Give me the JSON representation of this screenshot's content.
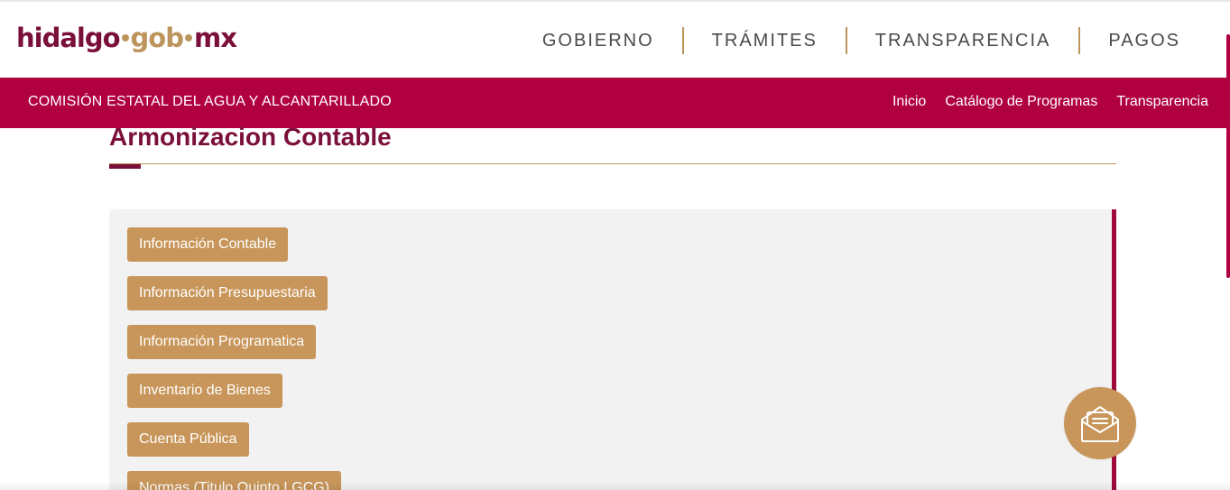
{
  "logo": {
    "part1": "hidalgo",
    "part2": "gob",
    "part3": "mx"
  },
  "main_nav": [
    "GOBIERNO",
    "TRÁMITES",
    "TRANSPARENCIA",
    "PAGOS"
  ],
  "sub_header": {
    "organization": "COMISIÓN ESTATAL DEL AGUA Y ALCANTARILLADO",
    "links": [
      "Inicio",
      "Catálogo de Programas",
      "Transparencia"
    ]
  },
  "page_title": "Armonizacion Contable",
  "section_buttons": [
    "Información Contable",
    "Información Presupuestaria",
    "Información Programatica",
    "Inventario de Bienes",
    "Cuenta Pública",
    "Normas (Titulo Quinto LGCG)"
  ],
  "fab": {
    "icon": "mail-envelope-icon"
  },
  "colors": {
    "brand_wine": "#b0003f",
    "title_wine": "#7a0f3a",
    "gold": "#c8965a",
    "panel_bg": "#f2f2f2"
  }
}
